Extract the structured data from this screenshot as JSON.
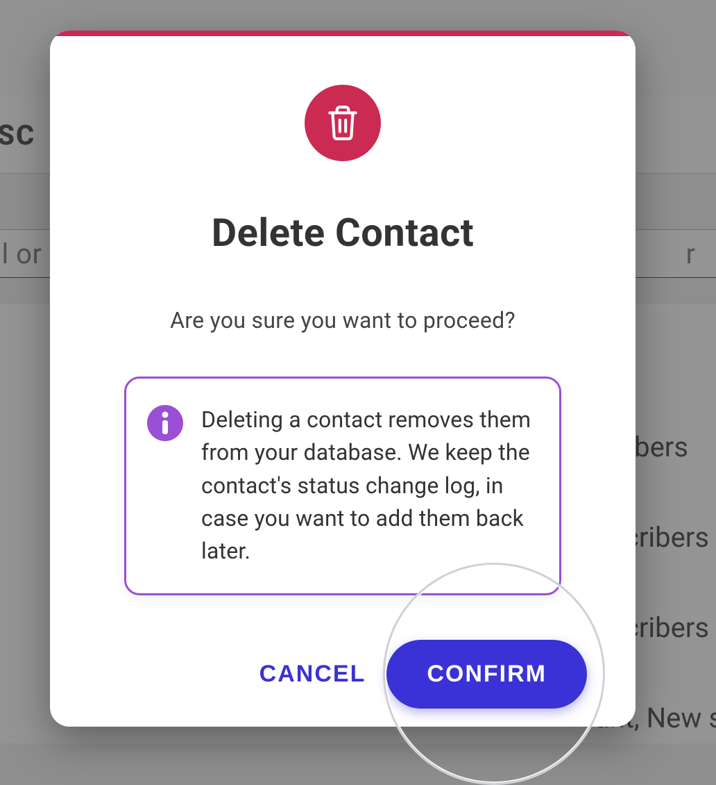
{
  "background": {
    "nav_label": "UBSC",
    "search_left": "ail or",
    "search_right": "r",
    "row1": "bers",
    "row2": "scribers",
    "row3": "scribers",
    "row4": "ant, New s"
  },
  "modal": {
    "icon_name": "trash-icon",
    "title": "Delete Contact",
    "subtitle": "Are you sure you want to proceed?",
    "info_text": "Deleting a contact removes them from your database. We keep the contact's status change log, in case you want to add them back later.",
    "actions": {
      "cancel": "CANCEL",
      "confirm": "CONFIRM"
    },
    "colors": {
      "accent": "#cd2a53",
      "primary": "#3a31d6",
      "info_border": "#9a4fd4"
    }
  }
}
